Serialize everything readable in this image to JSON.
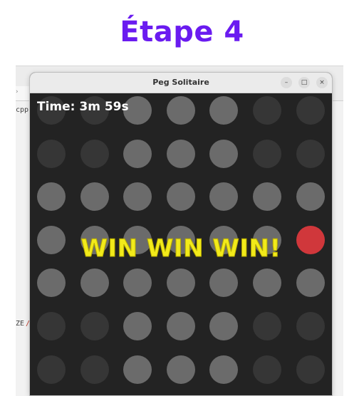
{
  "heading": "Étape 4",
  "background_window": {
    "snippet_top": "cpp",
    "snippet_mid": "ZE",
    "snippet_mid_slash": "/",
    "arrow": "›"
  },
  "window": {
    "title": "Peg Solitaire",
    "minimize_icon": "–",
    "maximize_icon": "□",
    "close_icon": "×"
  },
  "game": {
    "timer_text": "Time: 3m 59s",
    "message": "WIN WIN WIN!",
    "colors": {
      "peg": "#6b6b6b",
      "empty_hole": "#363636",
      "selected_peg": "#d0373b",
      "message": "#f2ea1a",
      "heading": "#6a1bf0"
    },
    "board": [
      [
        "empty",
        "empty",
        "peg",
        "peg",
        "peg",
        "empty",
        "empty"
      ],
      [
        "empty",
        "empty",
        "peg",
        "peg",
        "peg",
        "empty",
        "empty"
      ],
      [
        "peg",
        "peg",
        "peg",
        "peg",
        "peg",
        "peg",
        "peg"
      ],
      [
        "peg",
        "peg",
        "peg",
        "peg",
        "peg",
        "peg",
        "selected"
      ],
      [
        "peg",
        "peg",
        "peg",
        "peg",
        "peg",
        "peg",
        "peg"
      ],
      [
        "empty",
        "empty",
        "peg",
        "peg",
        "peg",
        "empty",
        "empty"
      ],
      [
        "empty",
        "empty",
        "peg",
        "peg",
        "peg",
        "empty",
        "empty"
      ]
    ]
  }
}
